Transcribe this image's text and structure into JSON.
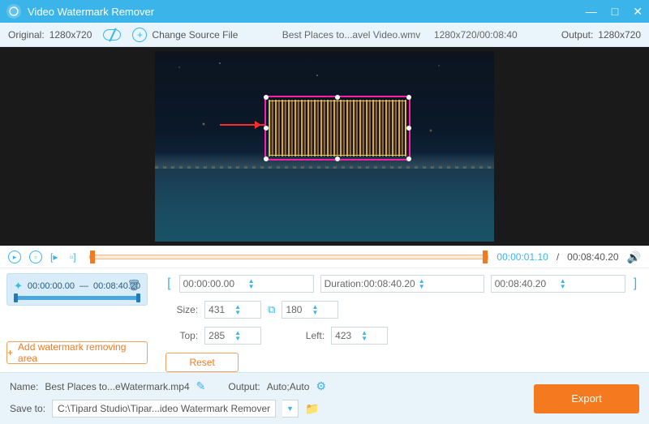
{
  "window": {
    "title": "Video Watermark Remover"
  },
  "toolbar": {
    "original_label": "Original:",
    "original_res": "1280x720",
    "change_source": "Change Source File",
    "filename": "Best Places to...avel Video.wmv",
    "file_res_time": "1280x720/00:08:40",
    "output_label": "Output:",
    "output_res": "1280x720"
  },
  "player": {
    "current": "00:00:01.10",
    "sep": "/",
    "total": "00:08:40.20"
  },
  "segment": {
    "start": "00:00:00.00",
    "dash": "—",
    "end": "00:08:40.20"
  },
  "add_area_label": "Add watermark removing area",
  "params": {
    "start": "00:00:00.00",
    "duration_label": "Duration:",
    "duration": "00:08:40.20",
    "end": "00:08:40.20",
    "size_label": "Size:",
    "size_w": "431",
    "size_h": "180",
    "top_label": "Top:",
    "top": "285",
    "left_label": "Left:",
    "left": "423",
    "reset": "Reset"
  },
  "bottom": {
    "name_label": "Name:",
    "name_value": "Best Places to...eWatermark.mp4",
    "output_label": "Output:",
    "output_value": "Auto;Auto",
    "save_label": "Save to:",
    "save_path": "C:\\Tipard Studio\\Tipar...ideo Watermark Remover",
    "export": "Export"
  }
}
